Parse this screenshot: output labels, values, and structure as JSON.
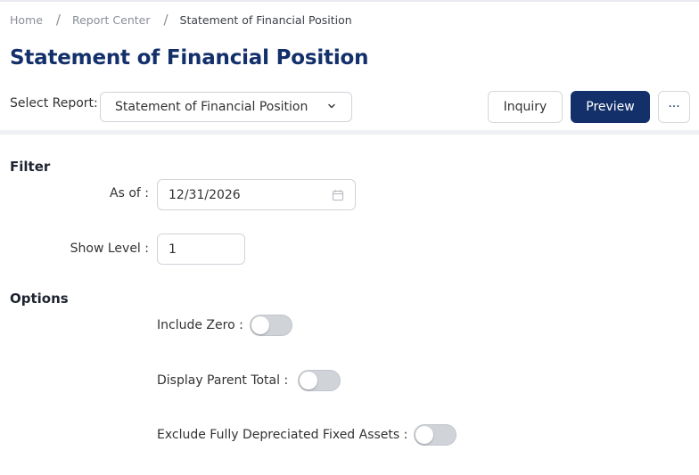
{
  "breadcrumb": {
    "items": [
      "Home",
      "Report Center",
      "Statement of Financial Position"
    ],
    "separator": "/"
  },
  "page": {
    "title": "Statement of Financial Position"
  },
  "report_selector": {
    "label": "Select Report:",
    "selected": "Statement of Financial Position",
    "icon": "chevron-down-icon"
  },
  "toolbar": {
    "inquiry_label": "Inquiry",
    "preview_label": "Preview",
    "more_label": "···"
  },
  "filter": {
    "title": "Filter",
    "as_of_label": "As of :",
    "as_of_value": "12/31/2026",
    "as_of_icon": "calendar-icon",
    "show_level_label": "Show Level :",
    "show_level_value": "1"
  },
  "options": {
    "title": "Options",
    "include_zero_label": "Include Zero :",
    "include_zero_on": false,
    "display_parent_total_label": "Display Parent Total :",
    "display_parent_total_on": false,
    "exclude_fixed_assets_label": "Exclude Fully Depreciated Fixed Assets :",
    "exclude_fixed_assets_on": false
  },
  "colors": {
    "brand": "#13306b",
    "toggle_off": "#d0d3d8",
    "border": "#cfd3d9"
  }
}
